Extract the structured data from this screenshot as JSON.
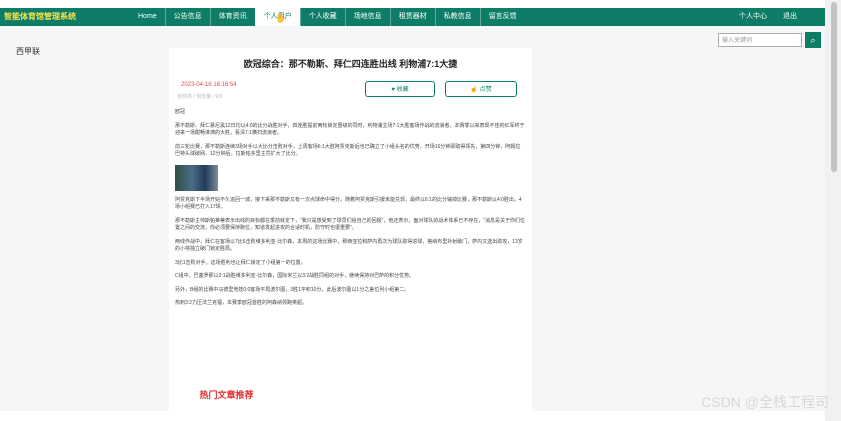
{
  "app": {
    "logo": "智能体育馆管理系统"
  },
  "nav": {
    "items": [
      "Home",
      "公告信息",
      "体育资讯",
      "个人用户",
      "个人收藏",
      "场地信息",
      "租赁器材",
      "私教信息",
      "留言反馈"
    ],
    "right": [
      "个人中心",
      "退出"
    ]
  },
  "sidebar": {
    "title": "西甲联"
  },
  "search": {
    "placeholder": "输入关键词",
    "button_icon": "search-icon"
  },
  "article": {
    "title": "欧冠综合：那不勒斯、拜仁四连胜出线 利物浦7:1大捷",
    "date": "2023-04-16 16:16:54",
    "meta": "自然体 / 浏览量 / 9/9",
    "fav_label": "收藏",
    "like_label": "点赞",
    "paragraphs": [
      "欧冠",
      "那不勒斯、拜仁慕尼黑12日均以4:0的比分战胜对手，四连胜提前两轮锁定晋级的同时，利物浦主场7:1大胜客场作战的流浪者，本赛季以来表现不佳的红军终于迎来一场酣畅淋漓的大胜，看清7:1横扫流浪者。",
      "前三轮比赛，那不勒斯连续3场对手以大比分击败对手，上周客场6:1大胜阿贾克斯后也已确立了小组头名的优势。开场16分钟即取得领先，第四分钟，阿姆拉巴特头球破网，12分钟后，拉斯帕多里主罚扩大了比分。",
      "阿贾克斯下半场开始不久追回一城，接下来那不勒斯又有一次点球命中得分。随着阿贾克斯引援未能兑现，最终以6:1的比分输掉比赛，那不勒斯以4:0胜出，4场小组赛已打入17球。",
      "那不勒斯主帅斯帕莱蒂表示出线的目标都在季前就定下，“我只是感受到了球员们给自己的回报”，他还表示，面对球队的战术体系已不存在，“消息是关于你们位置之间的交流，你必须要保持跑位，知道发起进攻的合适时机，防守时也很重要”。",
      "两线作战中，拜仁在客场以7比5击败维多利亚·比尔森，本周的这场比赛中，穆西亚拉和萨内再次为球队取得进球，格纳布里补射破门，萨内又送出助攻，13岁的小将独立破门锁定胜局。",
      "3比1击败对手，这场胜利也让拜仁锁定了小组第一的位置。",
      "C组中，巴塞罗那以2:1战胜维多利亚·比尔森，国际米兰以3:2战胜同组的对手，继续保持对巴萨的积分优势。",
      "另外，B组的比赛中马德里竞技0:0客场平局波尔图，3胜1平积10分，此后波尔图以1分之差位列小组第二。",
      "热刺3:2力压法兰克福，本赛季欧冠首胜的阿森纳领跑英超。"
    ],
    "image_alt": "比赛图片"
  },
  "hot": {
    "title": "热门文章推荐"
  },
  "watermark": "CSDN @全栈工程司"
}
